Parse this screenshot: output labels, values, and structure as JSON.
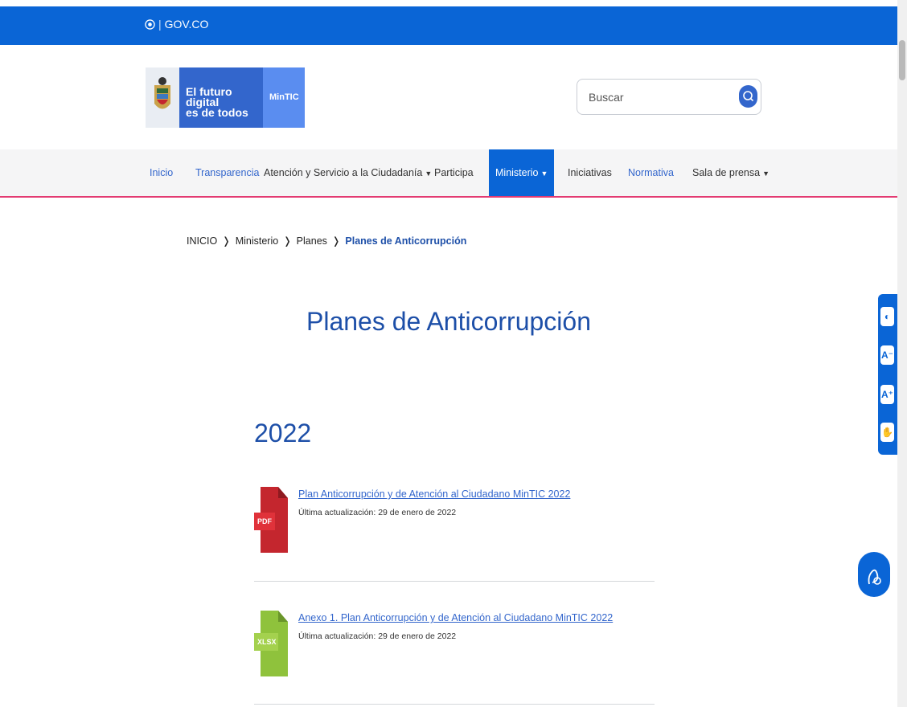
{
  "gov_bar": {
    "label": "GOV.CO"
  },
  "logo": {
    "line1": "El futuro digital",
    "line2": "es de todos",
    "brand": "MinTIC"
  },
  "search": {
    "placeholder": "Buscar"
  },
  "nav": {
    "items": [
      {
        "label": "Inicio"
      },
      {
        "label": "Transparencia"
      },
      {
        "label": "Atención y Servicio a la Ciudadanía"
      },
      {
        "label": "Participa"
      },
      {
        "label": "Ministerio"
      },
      {
        "label": "Iniciativas"
      },
      {
        "label": "Normativa"
      },
      {
        "label": "Sala de prensa"
      }
    ],
    "caret": "▼"
  },
  "breadcrumb": {
    "items": [
      "INICIO",
      "Ministerio",
      "Planes"
    ],
    "separator": "❭",
    "current": "Planes de Anticorrupción"
  },
  "page_title": "Planes de Anticorrupción",
  "year": "2022",
  "documents": [
    {
      "type": "PDF",
      "title": "Plan Anticorrupción y de Atención al Ciudadano MinTIC 2022",
      "updated": "Última actualización: 29 de enero de 2022"
    },
    {
      "type": "XLSX",
      "title": "Anexo 1. Plan Anticorrupción y de Atención al Ciudadano MinTIC 2022",
      "updated": "Última actualización: 29 de enero de 2022"
    }
  ],
  "accessibility": {
    "contrast": "◐",
    "decrease": "A⁻",
    "increase": "A⁺",
    "sign_language": "✋"
  },
  "colors": {
    "primary": "#0a65d6",
    "accent": "#e33a72",
    "pdf": "#c4262e",
    "xlsx": "#8fc23c"
  }
}
